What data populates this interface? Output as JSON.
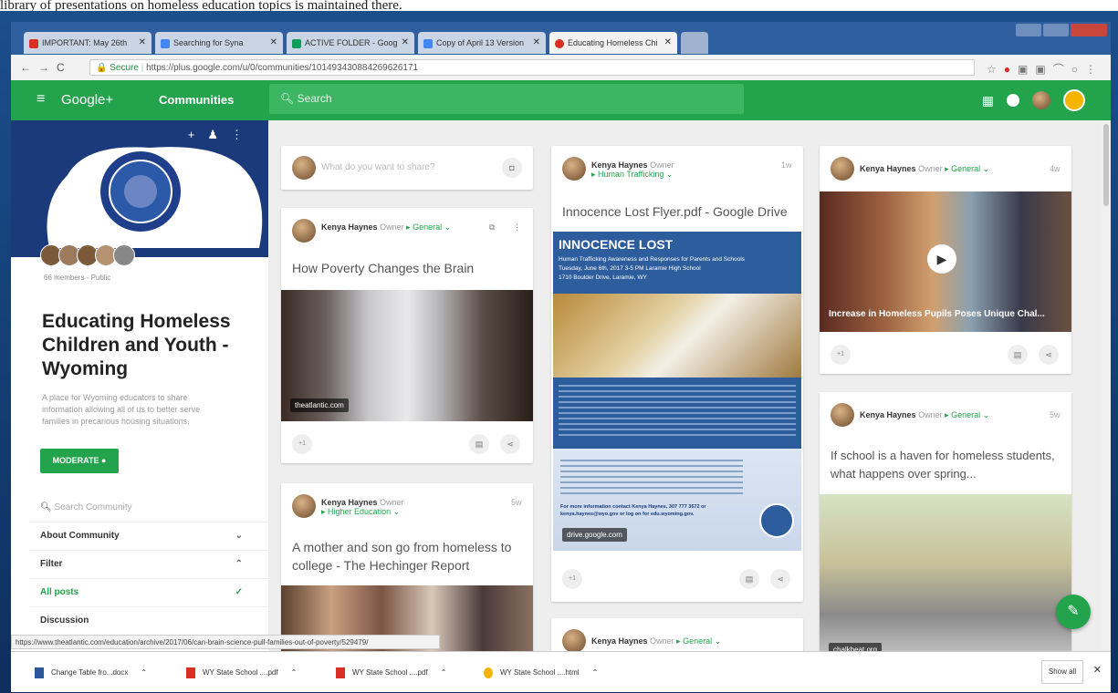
{
  "caption_above": "library of presentations on homeless education topics is maintained there.",
  "tabs": [
    {
      "label": "IMPORTANT: May 26th",
      "icon_color": "#d93025"
    },
    {
      "label": "Searching for Syna",
      "icon_color": "#4285f4"
    },
    {
      "label": "ACTIVE FOLDER - Goog",
      "icon_color": "#0f9d58"
    },
    {
      "label": "Copy of April 13 Version",
      "icon_color": "#4285f4"
    },
    {
      "label": "Educating Homeless Chi",
      "icon_color": "#d93025"
    }
  ],
  "address": {
    "secure": "Secure",
    "url": "https://plus.google.com/u/0/communities/101493430884269626171"
  },
  "gplus": {
    "menu_icon": "hamburger-icon",
    "brand": "Google+",
    "section": "Communities",
    "search_placeholder": "Search"
  },
  "community": {
    "members": "66 members - Public",
    "title": "Educating Homeless Children and Youth - Wyoming",
    "description": "A place for Wyoming educators to share information allowing all of us to better serve families in precarious housing situations.",
    "moderate": "MODERATE",
    "search_placeholder": "Search Community",
    "about": "About Community",
    "filter": "Filter",
    "all_posts": "All posts",
    "discussion": "Discussion"
  },
  "share_prompt": "What do you want to share?",
  "author": "Kenya Haynes",
  "owner": "Owner",
  "posts": {
    "p1": {
      "category": "General",
      "title": "How Poverty Changes the Brain",
      "source": "theatlantic.com",
      "plus": "+1"
    },
    "p2": {
      "category": "Higher Education",
      "time": "5w",
      "title": "A mother and son go from homeless to college - The Hechinger Report"
    },
    "p3": {
      "category": "Human Trafficking",
      "time": "1w",
      "title": "Innocence Lost Flyer.pdf - Google Drive",
      "flyer_title": "INNOCENCE LOST",
      "flyer_sub": "Human Trafficking Awareness and Responses for Parents and Schools",
      "flyer_date": "Tuesday, June 6th, 2017 3-5 PM Laramie High School",
      "flyer_addr": "1710 Boulder Drive, Laramie, WY",
      "flyer_contact": "For more information contact Kenya Haynes, 307 777 3672 or kenya.haynes@wyo.gov or log on for edu.wyoming.gov.",
      "source": "drive.google.com",
      "plus": "+1"
    },
    "p4": {
      "category": "General",
      "time": "4w",
      "video_title": "Increase in Homeless Pupils Poses Unique Chal...",
      "plus": "+1"
    },
    "p5": {
      "category": "General",
      "time": "5w",
      "title": "If school is a haven for homeless students, what happens over spring...",
      "source": "chalkbeat.org"
    },
    "p6": {
      "category": "General"
    }
  },
  "status_url": "https://www.theatlantic.com/education/archive/2017/06/can-brain-science-pull-families-out-of-poverty/529479/",
  "downloads": [
    {
      "label": "Change Table fro...docx",
      "color": "#2b579a"
    },
    {
      "label": "WY State School ....pdf",
      "color": "#d93025"
    },
    {
      "label": "WY State School ....pdf",
      "color": "#d93025"
    },
    {
      "label": "WY State School ....html",
      "color": "#f4b400"
    }
  ],
  "show_all": "Show all"
}
